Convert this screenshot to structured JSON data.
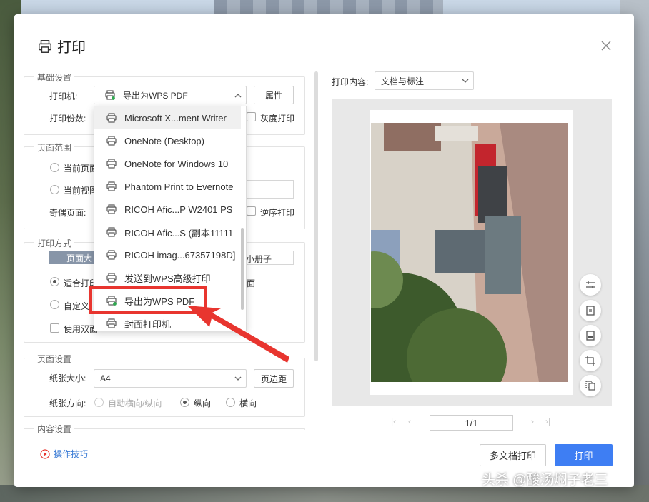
{
  "dialog": {
    "title": "打印",
    "icon": "printer-icon",
    "close_icon": "close-icon"
  },
  "basic": {
    "section_title": "基础设置",
    "printer_label": "打印机:",
    "printer_value": "导出为WPS PDF",
    "properties_button": "属性",
    "copies_label": "打印份数:",
    "grayscale_label": "灰度打印"
  },
  "page_range": {
    "section_title": "页面范围",
    "current_page_label": "当前页面",
    "current_view_label": "当前视图",
    "odd_even_label": "奇偶页面:",
    "reverse_label": "逆序打印"
  },
  "print_mode": {
    "section_title": "打印方式",
    "tab_label": "页面大",
    "booklet_label": "小册子",
    "fit_label": "适合打印",
    "page_suffix": "面",
    "custom_label": "自定义",
    "duplex_label": "使用双面"
  },
  "page_setup": {
    "section_title": "页面设置",
    "paper_size_label": "纸张大小:",
    "paper_size_value": "A4",
    "margins_button": "页边距",
    "orientation_label": "纸张方向:",
    "auto_orientation": "自动横向/纵向",
    "portrait": "纵向",
    "landscape": "横向",
    "selected_orientation": "纵向"
  },
  "content_setup": {
    "section_title": "内容设置"
  },
  "printer_dropdown": {
    "items": [
      "Microsoft X...ment Writer",
      "OneNote (Desktop)",
      "OneNote for Windows 10",
      "Phantom Print to Evernote",
      "RICOH Afic...P W2401 PS",
      "RICOH Afic...S (副本11111",
      "RICOH imag...67357198D]",
      "发送到WPS高级打印",
      "导出为WPS PDF",
      "封面打印机"
    ],
    "hovered_item": "Microsoft X...ment Writer",
    "selected_item": "导出为WPS PDF",
    "annotation_color": "#e8352f"
  },
  "preview": {
    "content_label": "打印内容:",
    "content_value": "文档与标注",
    "page_indicator": "1/1",
    "tools": [
      "adjust-icon",
      "fit-page-icon",
      "save-page-icon",
      "crop-icon",
      "copy-icon"
    ]
  },
  "footer": {
    "tips_label": "操作技巧",
    "multi_doc_button": "多文档打印",
    "print_button": "打印",
    "accent_color": "#3e7ef3"
  },
  "watermark": {
    "text": "头杀 @酸汤焖子老三"
  }
}
